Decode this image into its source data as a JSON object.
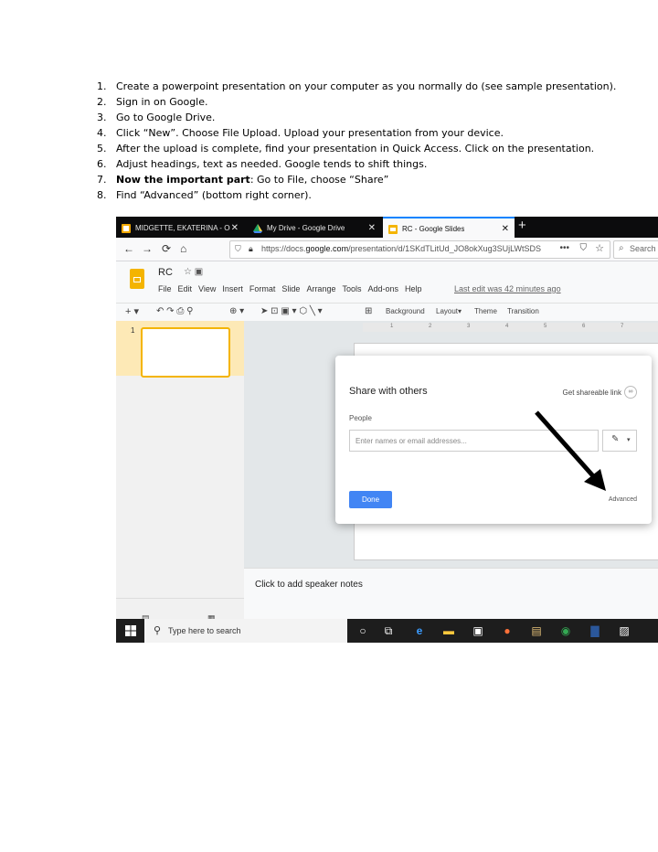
{
  "steps": [
    {
      "num": "1.",
      "text": "Create a powerpoint presentation on your computer as you normally do (see sample presentation)."
    },
    {
      "num": "2.",
      "text": "Sign in on Google."
    },
    {
      "num": "3.",
      "text": "Go to Google Drive."
    },
    {
      "num": "4.",
      "text": "Click “New”. Choose File Upload. Upload your presentation from your device."
    },
    {
      "num": "5.",
      "text": "After the upload is complete, find your presentation in Quick Access. Click on the presentation."
    },
    {
      "num": "6.",
      "text": "Adjust headings, text as needed. Google tends to shift things."
    },
    {
      "num": "7.",
      "bold": "Now the important part",
      "text": ": Go to File, choose “Share”"
    },
    {
      "num": "8.",
      "text": "Find “Advanced” (bottom right corner)."
    }
  ],
  "browser": {
    "tabs": [
      {
        "label": "MIDGETTE, EKATERINA - Outlo",
        "icon": "outlook-icon"
      },
      {
        "label": "My Drive - Google Drive",
        "icon": "drive-icon"
      },
      {
        "label": "RC - Google Slides",
        "icon": "slides-icon"
      }
    ],
    "url_prefix": "https://docs.",
    "url_domain": "google.com",
    "url_rest": "/presentation/d/1SKdTLitUd_JO8okXug3SUjLWtSDS",
    "search_placeholder": "Search"
  },
  "slides_app": {
    "doc_title": "RC",
    "menus": [
      "File",
      "Edit",
      "View",
      "Insert",
      "Format",
      "Slide",
      "Arrange",
      "Tools",
      "Add-ons",
      "Help"
    ],
    "last_edit": "Last edit was 42 minutes ago",
    "toolbar": {
      "background": "Background",
      "layout": "Layout",
      "theme": "Theme",
      "transition": "Transition"
    },
    "ruler_ticks": [
      "1",
      "2",
      "3",
      "4",
      "5",
      "6",
      "7"
    ],
    "slide_number": "1",
    "speaker_notes": "Click to add speaker notes"
  },
  "share_dialog": {
    "title": "Share with others",
    "shareable_link": "Get shareable link",
    "people_label": "People",
    "input_placeholder": "Enter names or email addresses...",
    "done_label": "Done",
    "advanced_label": "Advanced"
  },
  "taskbar": {
    "search_text": "Type here to search"
  }
}
